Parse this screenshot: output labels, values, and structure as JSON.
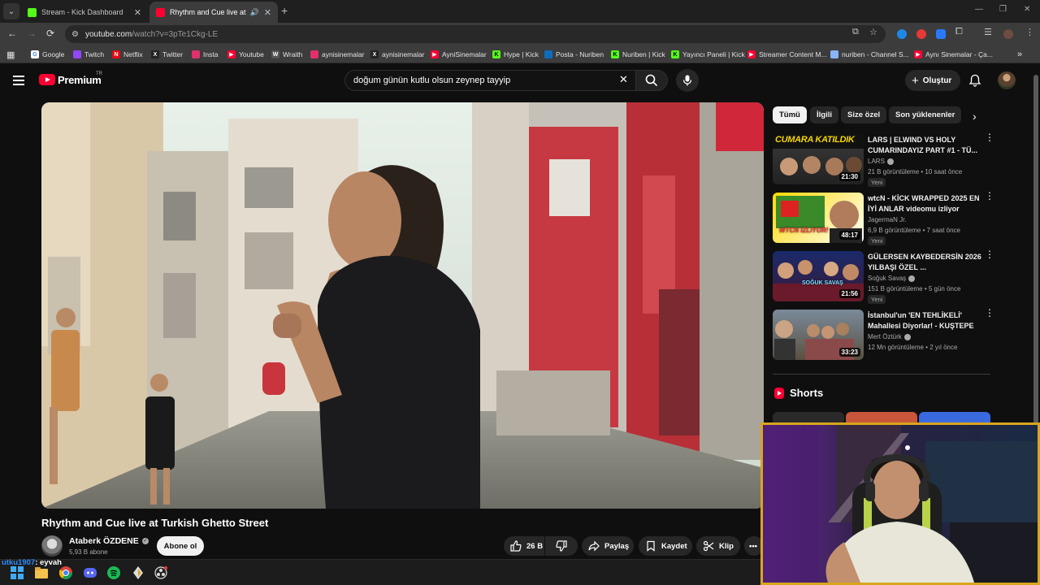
{
  "browser": {
    "tabs": [
      {
        "title": "Stream - Kick Dashboard",
        "active": false,
        "favicon_color": "#53fc18"
      },
      {
        "title": "Rhythm and Cue live at Turki",
        "active": true,
        "favicon_color": "#ff0033",
        "audio": true
      }
    ],
    "url_host": "youtube.com",
    "url_path": "/watch?v=3pTe1Ckg-LE",
    "bookmarks": [
      {
        "label": "Google",
        "icon": "google-icon",
        "color": "#ffffff"
      },
      {
        "label": "Twitch",
        "icon": "twitch-icon",
        "color": "#9146ff"
      },
      {
        "label": "Netflix",
        "icon": "netflix-icon",
        "color": "#e50914"
      },
      {
        "label": "Twitter",
        "icon": "x-icon",
        "color": "#000000"
      },
      {
        "label": "Insta",
        "icon": "instagram-icon",
        "color": "#e1306c"
      },
      {
        "label": "Youtube",
        "icon": "youtube-icon",
        "color": "#ff0033"
      },
      {
        "label": "Wraith",
        "icon": "wraith-icon",
        "color": "#555555"
      },
      {
        "label": "aynisinemalar",
        "icon": "instagram-icon",
        "color": "#e1306c"
      },
      {
        "label": "aynisinemalar",
        "icon": "x-icon",
        "color": "#000000"
      },
      {
        "label": "AyniSinemalar",
        "icon": "youtube-icon",
        "color": "#ff0033"
      },
      {
        "label": "Hype | Kick",
        "icon": "kick-icon",
        "color": "#53fc18"
      },
      {
        "label": "Posta - Nuriben",
        "icon": "outlook-icon",
        "color": "#0f6cbd"
      },
      {
        "label": "Nuriben | Kick",
        "icon": "kick-icon",
        "color": "#53fc18"
      },
      {
        "label": "Yayıncı Paneli | Kick",
        "icon": "kick-icon",
        "color": "#53fc18"
      },
      {
        "label": "Streamer Content M...",
        "icon": "youtube-icon",
        "color": "#ff0033"
      },
      {
        "label": "nuriben - Channel S...",
        "icon": "channel-icon",
        "color": "#8ab4f8"
      },
      {
        "label": "Aynı Sinemalar - Ça...",
        "icon": "youtube-icon",
        "color": "#ff0033"
      }
    ]
  },
  "youtube": {
    "brand": "Premium",
    "country": "TR",
    "search_query": "doğum günün kutlu olsun zeynep tayyip",
    "create_label": "Oluştur",
    "video": {
      "title": "Rhythm and Cue live at Turkish Ghetto Street",
      "channel": "Ataberk ÖZDENE",
      "subs": "5,93 B abone",
      "subscribe_label": "Abone ol",
      "likes": "26 B",
      "share_label": "Paylaş",
      "save_label": "Kaydet",
      "clip_label": "Klip"
    },
    "chips": [
      "Tümü",
      "İlgili",
      "Size özel",
      "Son yüklenenler"
    ],
    "recommendations": [
      {
        "title": "LARS | ELWIND VS HOLY CUMARINDAYIZ PART #1 - TÜ...",
        "channel": "LARS",
        "verified": true,
        "views": "21 B görüntüleme",
        "age": "10 saat önce",
        "badge": "Yeni",
        "duration": "21:30",
        "thumb_text": "CUMARA KATILDIK"
      },
      {
        "title": "wtcN - KİCK WRAPPED 2025 EN İYİ ANLAR videomu izliyor",
        "channel": "JagermaN Jr.",
        "verified": false,
        "views": "6,9 B görüntüleme",
        "age": "7 saat önce",
        "badge": "Yeni",
        "duration": "48:17",
        "thumb_text": "WTCN İZLİYOR!"
      },
      {
        "title": "GÜLERSEN KAYBEDERSİN 2026 YILBAŞI ÖZEL ...",
        "channel": "Soğuk Savaş",
        "verified": true,
        "views": "151 B görüntüleme",
        "age": "5 gün önce",
        "badge": "Yeni",
        "duration": "21:56",
        "thumb_text": "SOĞUK SAVAŞ"
      },
      {
        "title": "İstanbul'un 'EN TEHLİKELİ' Mahallesi Diyorlar! - KUŞTEPE ...",
        "channel": "Mert Öztürk",
        "verified": true,
        "views": "12 Mn görüntüleme",
        "age": "2 yıl önce",
        "badge": "",
        "duration": "33:23",
        "thumb_text": ""
      }
    ],
    "shorts_title": "Shorts"
  },
  "chat": {
    "user": "utku1907",
    "sep": ":",
    "message": "eyvah"
  }
}
